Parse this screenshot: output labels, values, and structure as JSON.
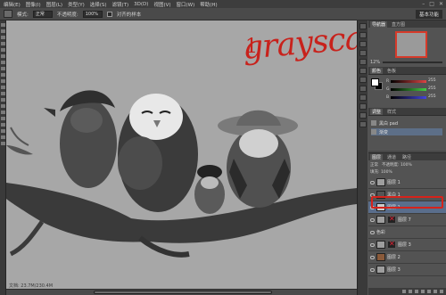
{
  "menubar": {
    "items": [
      "编辑(E)",
      "图像(I)",
      "图层(L)",
      "类型(Y)",
      "选择(S)",
      "滤镜(T)",
      "3D(D)",
      "视图(V)",
      "窗口(W)",
      "帮助(H)"
    ],
    "window_buttons": [
      "–",
      "□",
      "✕"
    ]
  },
  "options": {
    "mode_label": "模式:",
    "mode_value": "正常",
    "opacity_label": "不透明度:",
    "opacity_value": "100%",
    "align_label": "对齐的样本",
    "workspace": "基本功能"
  },
  "annotation": {
    "number": "1",
    "text": "grayscale"
  },
  "navigator": {
    "tabs": [
      "导航器",
      "直方图"
    ],
    "zoom": "12%"
  },
  "color_panel": {
    "tabs": [
      "颜色",
      "色板"
    ],
    "channels": [
      {
        "name": "R",
        "value": "255",
        "color": "#d44"
      },
      {
        "name": "G",
        "value": "255",
        "color": "#4c4"
      },
      {
        "name": "B",
        "value": "255",
        "color": "#44d"
      }
    ]
  },
  "adjustments": {
    "tabs": [
      "调整",
      "样式"
    ],
    "items": [
      "黑白 pad",
      "渐变"
    ]
  },
  "layers": {
    "tabs": [
      "图层",
      "通道",
      "路径"
    ],
    "blend_label": "正常",
    "opacity_label": "不透明度: 100%",
    "fill_label": "填充: 100%",
    "rows": [
      {
        "name": "图层 1",
        "active": false,
        "mask": ""
      },
      {
        "name": "黑白 1",
        "active": false,
        "mask": ""
      },
      {
        "name": "图层 1",
        "active": true,
        "mask": ""
      },
      {
        "name": "图层 7",
        "active": false,
        "mask": "x"
      },
      {
        "name": "色彩",
        "active": false,
        "mask": ""
      },
      {
        "name": "图层 3",
        "active": false,
        "mask": "x"
      },
      {
        "name": "图层 2",
        "active": false,
        "mask": ""
      },
      {
        "name": "图层 3",
        "active": false,
        "mask": ""
      }
    ]
  },
  "status": {
    "text": "文档: 23.7M/230.4M"
  },
  "colors": {
    "canvas": "#a7a7a7",
    "highlight": "#d6231b",
    "annotation": "#c8221c"
  }
}
